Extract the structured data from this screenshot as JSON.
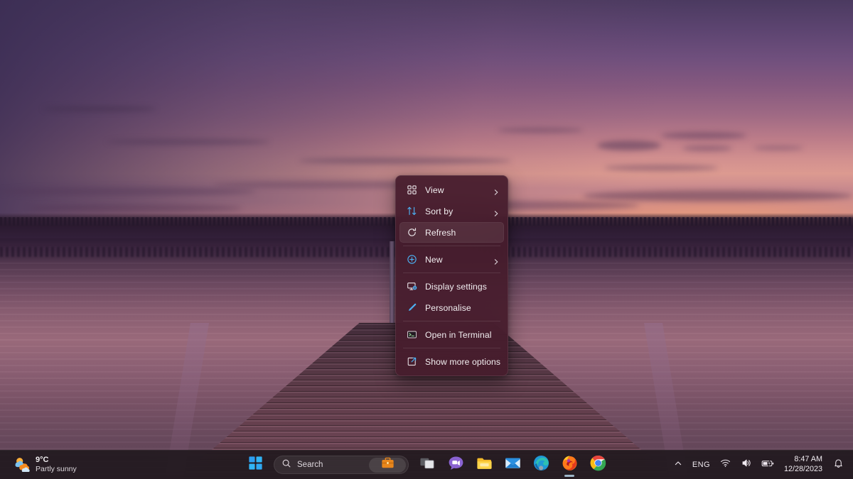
{
  "desktop": {
    "wallpaper_description": "Purple sunset over a lake with a wooden dock",
    "colors": {
      "sky_top": "#4b3a60",
      "sky_bottom": "#dc9a90",
      "horizon_glow": "#ffb06e",
      "water": "#8a5e72",
      "treeline": "#2b1a30",
      "dock": "#6a4352"
    }
  },
  "context_menu": {
    "background": "#461c2c",
    "accent": "#4cb3f5",
    "items": [
      {
        "label": "View",
        "icon": "grid-icon",
        "submenu": true,
        "hovered": false,
        "separator_after": false
      },
      {
        "label": "Sort by",
        "icon": "sort-icon",
        "submenu": true,
        "hovered": false,
        "separator_after": false
      },
      {
        "label": "Refresh",
        "icon": "refresh-icon",
        "submenu": false,
        "hovered": true,
        "separator_after": true
      },
      {
        "label": "New",
        "icon": "new-plus-icon",
        "submenu": true,
        "hovered": false,
        "separator_after": true
      },
      {
        "label": "Display settings",
        "icon": "display-settings-icon",
        "submenu": false,
        "hovered": false,
        "separator_after": false
      },
      {
        "label": "Personalise",
        "icon": "personalise-icon",
        "submenu": false,
        "hovered": false,
        "separator_after": true
      },
      {
        "label": "Open in Terminal",
        "icon": "terminal-icon",
        "submenu": false,
        "hovered": false,
        "separator_after": true
      },
      {
        "label": "Show more options",
        "icon": "show-more-icon",
        "submenu": false,
        "hovered": false,
        "separator_after": false
      }
    ]
  },
  "taskbar": {
    "weather": {
      "temperature": "9°C",
      "condition": "Partly sunny",
      "icon": "partly-sunny-icon"
    },
    "start": {
      "label": "Start",
      "icon": "windows-logo-icon"
    },
    "search": {
      "placeholder": "Search",
      "icon": "search-icon",
      "chip_icon": "briefcase-icon"
    },
    "apps": [
      {
        "name": "Task View",
        "icon": "task-view-icon",
        "running": false
      },
      {
        "name": "Chat",
        "icon": "chat-icon",
        "running": false
      },
      {
        "name": "File Explorer",
        "icon": "file-explorer-icon",
        "running": false
      },
      {
        "name": "Mail",
        "icon": "mail-icon",
        "running": false
      },
      {
        "name": "Microsoft Edge",
        "icon": "edge-icon",
        "running": false
      },
      {
        "name": "Firefox",
        "icon": "firefox-icon",
        "running": true
      },
      {
        "name": "Google Chrome",
        "icon": "chrome-icon",
        "running": false
      }
    ],
    "tray": {
      "overflow_icon": "chevron-up-icon",
      "language": "ENG",
      "network_icon": "wifi-icon",
      "volume_icon": "volume-icon",
      "battery_icon": "battery-charging-icon",
      "time": "8:47 AM",
      "date": "12/28/2023",
      "notifications_icon": "bell-icon"
    }
  }
}
